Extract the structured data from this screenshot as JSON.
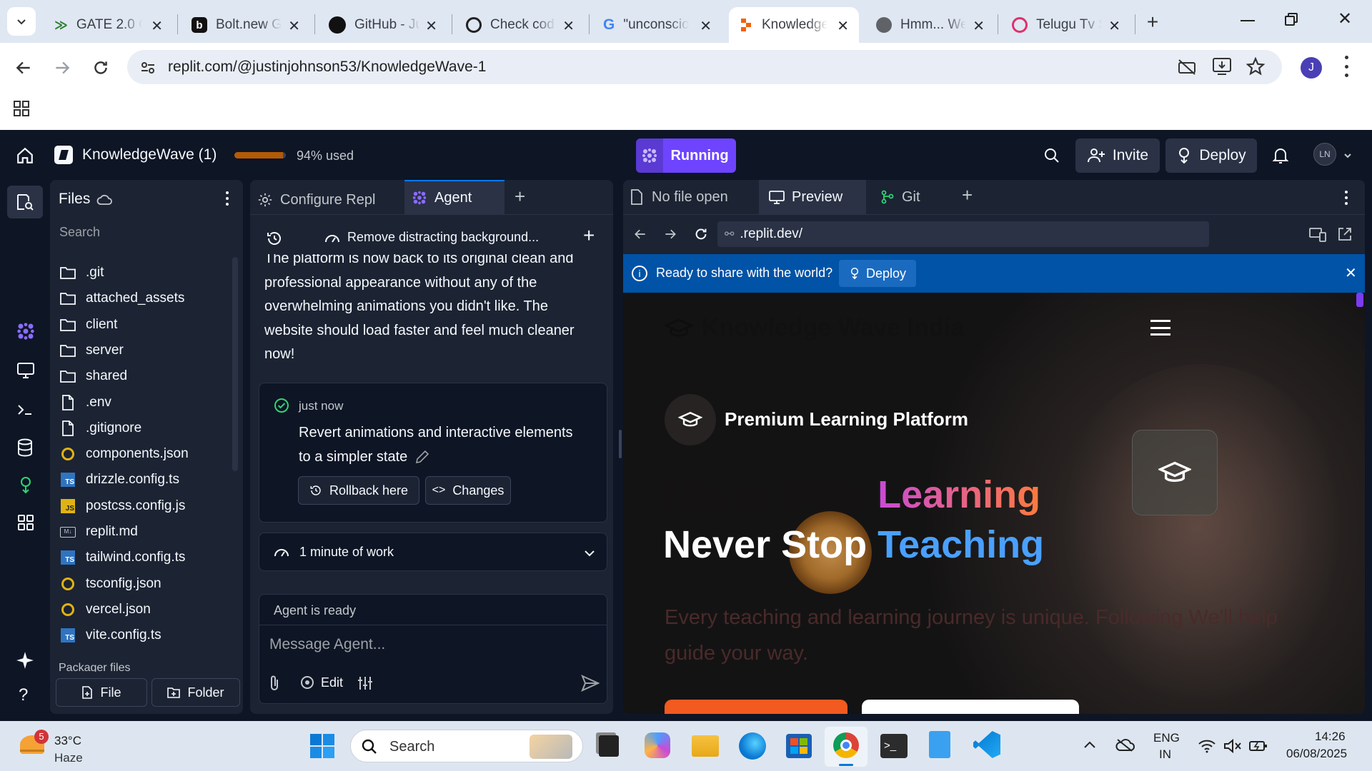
{
  "browser": {
    "tabs": [
      {
        "title": "GATE 2.0 C",
        "icon": "gate-icon"
      },
      {
        "title": "Bolt.new G",
        "icon": "bolt-icon"
      },
      {
        "title": "GitHub - Ju",
        "icon": "github-icon"
      },
      {
        "title": "Check cod",
        "icon": "chatgpt-icon"
      },
      {
        "title": "\"unconscio",
        "icon": "google-icon"
      },
      {
        "title": "Knowledge",
        "icon": "replit-icon",
        "active": true
      },
      {
        "title": "Hmm... We",
        "icon": "globe-icon"
      },
      {
        "title": "Telugu Tv S",
        "icon": "telugu-icon"
      }
    ],
    "url": "replit.com/@justinjohnson53/KnowledgeWave-1",
    "profile_initial": "J"
  },
  "replit": {
    "project_name": "KnowledgeWave (1)",
    "usage_text": "94% used",
    "usage_fraction": 0.94,
    "run_status": "Running",
    "invite_label": "Invite",
    "deploy_label": "Deploy",
    "user_initials": "LN",
    "files": {
      "title": "Files",
      "search_placeholder": "Search",
      "items": [
        {
          "name": ".git",
          "type": "folder"
        },
        {
          "name": "attached_assets",
          "type": "folder"
        },
        {
          "name": "client",
          "type": "folder"
        },
        {
          "name": "server",
          "type": "folder"
        },
        {
          "name": "shared",
          "type": "folder"
        },
        {
          "name": ".env",
          "type": "file"
        },
        {
          "name": ".gitignore",
          "type": "file"
        },
        {
          "name": "components.json",
          "type": "json"
        },
        {
          "name": "drizzle.config.ts",
          "type": "ts"
        },
        {
          "name": "postcss.config.js",
          "type": "js"
        },
        {
          "name": "replit.md",
          "type": "md"
        },
        {
          "name": "tailwind.config.ts",
          "type": "ts"
        },
        {
          "name": "tsconfig.json",
          "type": "json"
        },
        {
          "name": "vercel.json",
          "type": "json"
        },
        {
          "name": "vite.config.ts",
          "type": "ts"
        }
      ],
      "packager_label": "Packager files",
      "new_file_label": "File",
      "new_folder_label": "Folder"
    },
    "center_tabs": {
      "configure": "Configure Repl",
      "agent": "Agent"
    },
    "agent": {
      "thread_title": "Remove distracting background...",
      "message_lines": [
        "The platform is now back to its original clean and",
        "professional appearance without any of the",
        "overwhelming animations you didn't like. The",
        "website should load faster and feel much cleaner",
        "now!"
      ],
      "checkpoint_time": "just now",
      "checkpoint_lines": [
        "Revert animations and interactive elements",
        "to a simpler state"
      ],
      "rollback_label": "Rollback here",
      "changes_label": "Changes",
      "work_label": "1 minute of work",
      "status": "Agent is ready",
      "input_placeholder": "Message Agent...",
      "edit_label": "Edit"
    },
    "right_tabs": {
      "nofile": "No file open",
      "preview": "Preview",
      "git": "Git"
    },
    "preview": {
      "url": ".replit.dev/",
      "banner_text": "Ready to share with the world?",
      "banner_deploy": "Deploy",
      "site_brand": "Knowledge Wave India",
      "badge_text": "Premium Learning Platform",
      "headline1_a": "Never Stop ",
      "headline1_b": "Learning",
      "headline2_a": "Never Stop ",
      "headline2_b": "Teaching",
      "sub_line1": "Every teaching and learning journey is unique. Following We'll help",
      "sub_line2": "guide your way."
    }
  },
  "taskbar": {
    "weather_temp": "33°C",
    "weather_desc": "Haze",
    "weather_badge": "5",
    "search_placeholder": "Search",
    "lang_1": "ENG",
    "lang_2": "IN",
    "time": "14:26",
    "date": "06/08/2025"
  },
  "colors": {
    "replit_bg": "#0e1525",
    "panel_bg": "#1c2333",
    "running_purple": "#6e44ff",
    "banner_blue": "#0053a6",
    "learning_gradient": [
      "#c84bd6",
      "#ff7a3d"
    ],
    "teaching_blue": "#4aa0ff"
  }
}
